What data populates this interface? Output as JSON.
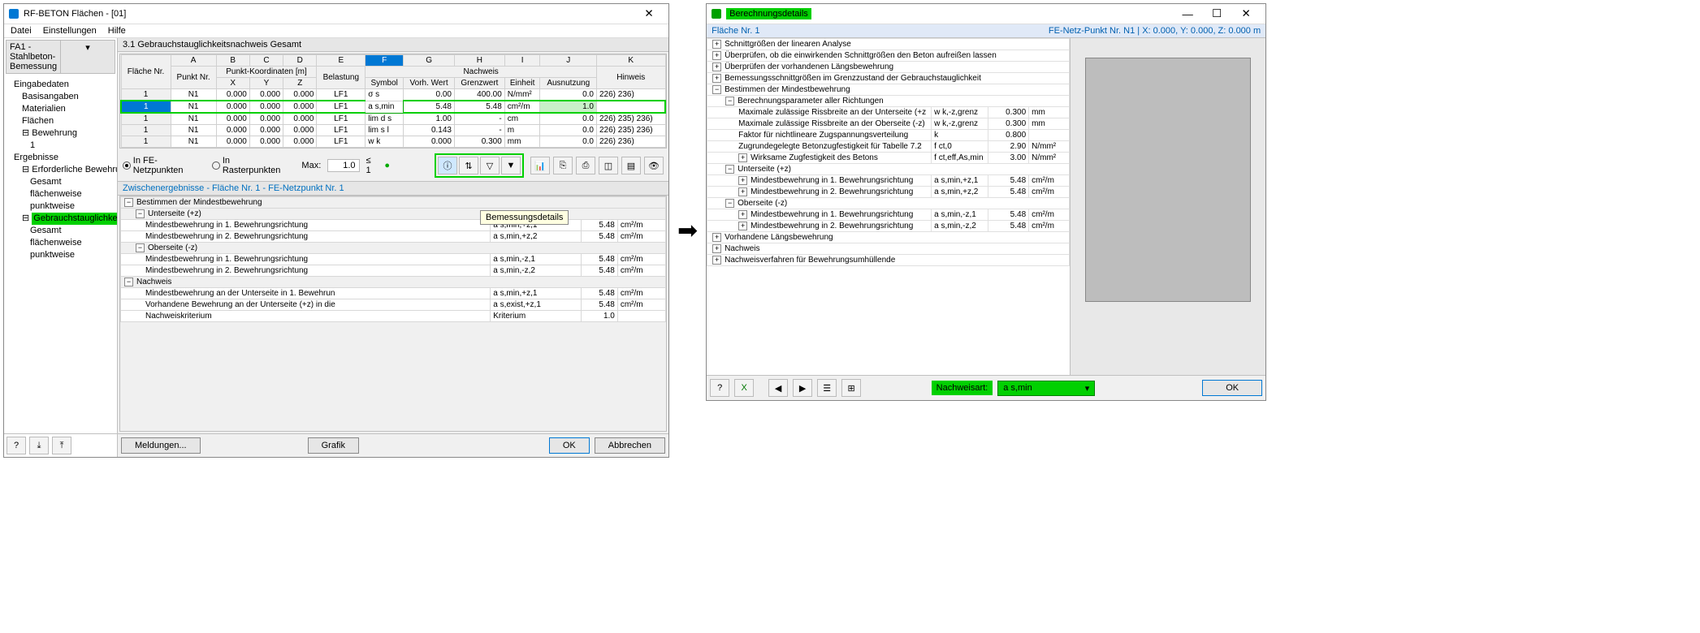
{
  "left": {
    "title": "RF-BETON Flächen - [01]",
    "menus": [
      "Datei",
      "Einstellungen",
      "Hilfe"
    ],
    "case_combo": "FA1 - Stahlbeton-Bemessung",
    "tree": {
      "input": "Eingabedaten",
      "input_items": [
        "Basisangaben",
        "Materialien",
        "Flächen"
      ],
      "bewehrung": "Bewehrung",
      "bewehrung_item": "1",
      "results": "Ergebnisse",
      "req": "Erforderliche Bewehrung",
      "req_items": [
        "Gesamt",
        "flächenweise",
        "punktweise"
      ],
      "gtn": "Gebrauchstauglichkeitsnachweis",
      "gtn_items": [
        "Gesamt",
        "flächenweise",
        "punktweise"
      ]
    },
    "section_title": "3.1 Gebrauchstauglichkeitsnachweis Gesamt",
    "table": {
      "letters": [
        "A",
        "B",
        "C",
        "D",
        "E",
        "F",
        "G",
        "H",
        "I",
        "J",
        "K"
      ],
      "headers": {
        "flaeche_nr": "Fläche\nNr.",
        "punkt_nr": "Punkt\nNr.",
        "pk_group": "Punkt-Koordinaten [m]",
        "x": "X",
        "y": "Y",
        "z": "Z",
        "belastung": "Belastung",
        "nw_group": "Nachweis",
        "symbol": "Symbol",
        "vorh": "Vorh. Wert",
        "grenz": "Grenzwert",
        "einheit": "Einheit",
        "ausnutz": "Ausnutzung",
        "hinweis": "Hinweis"
      },
      "rows": [
        {
          "fn": "1",
          "pn": "N1",
          "x": "0.000",
          "y": "0.000",
          "z": "0.000",
          "bel": "LF1",
          "sym": "σ s",
          "vw": "0.00",
          "gw": "400.00",
          "eh": "N/mm²",
          "an": "0.0",
          "hw": "226) 236)"
        },
        {
          "fn": "1",
          "pn": "N1",
          "x": "0.000",
          "y": "0.000",
          "z": "0.000",
          "bel": "LF1",
          "sym": "a s,min",
          "vw": "5.48",
          "gw": "5.48",
          "eh": "cm²/m",
          "an": "1.0",
          "hw": "",
          "hl": true
        },
        {
          "fn": "1",
          "pn": "N1",
          "x": "0.000",
          "y": "0.000",
          "z": "0.000",
          "bel": "LF1",
          "sym": "lim d s",
          "vw": "1.00",
          "gw": "-",
          "eh": "cm",
          "an": "0.0",
          "hw": "226) 235) 236)"
        },
        {
          "fn": "1",
          "pn": "N1",
          "x": "0.000",
          "y": "0.000",
          "z": "0.000",
          "bel": "LF1",
          "sym": "lim s l",
          "vw": "0.143",
          "gw": "-",
          "eh": "m",
          "an": "0.0",
          "hw": "226) 235) 236)"
        },
        {
          "fn": "1",
          "pn": "N1",
          "x": "0.000",
          "y": "0.000",
          "z": "0.000",
          "bel": "LF1",
          "sym": "w k",
          "vw": "0.000",
          "gw": "0.300",
          "eh": "mm",
          "an": "0.0",
          "hw": "226) 236)"
        }
      ]
    },
    "controls": {
      "radio1": "In FE-Netzpunkten",
      "radio2": "In Rasterpunkten",
      "max_label": "Max:",
      "max_value": "1.0",
      "max_cond": "≤ 1"
    },
    "tooltip": "Bemessungsdetails",
    "zw_title": "Zwischenergebnisse  -  Fläche Nr. 1 - FE-Netzpunkt Nr. 1",
    "zw": {
      "bestimmen": "Bestimmen der Mindestbewehrung",
      "unter": "Unterseite (+z)",
      "r1": "Mindestbewehrung in 1. Bewehrungsrichtung",
      "r1s": "a s,min,+z,1",
      "r1v": "5.48",
      "r1u": "cm²/m",
      "r2": "Mindestbewehrung in 2. Bewehrungsrichtung",
      "r2s": "a s,min,+z,2",
      "r2v": "5.48",
      "r2u": "cm²/m",
      "ober": "Oberseite (-z)",
      "r3": "Mindestbewehrung in 1. Bewehrungsrichtung",
      "r3s": "a s,min,-z,1",
      "r3v": "5.48",
      "r3u": "cm²/m",
      "r4": "Mindestbewehrung in 2. Bewehrungsrichtung",
      "r4s": "a s,min,-z,2",
      "r4v": "5.48",
      "r4u": "cm²/m",
      "nachweis": "Nachweis",
      "r5": "Mindestbewehrung an der Unterseite in 1. Bewehrun",
      "r5s": "a s,min,+z,1",
      "r5v": "5.48",
      "r5u": "cm²/m",
      "r6": "Vorhandene Bewehrung an der Unterseite (+z) in die",
      "r6s": "a s,exist,+z,1",
      "r6v": "5.48",
      "r6u": "cm²/m",
      "r7": "Nachweiskriterium",
      "r7s": "Kriterium",
      "r7v": "1.0",
      "r7u": ""
    },
    "footer": {
      "meldungen": "Meldungen...",
      "grafik": "Grafik",
      "ok": "OK",
      "abbrechen": "Abbrechen"
    }
  },
  "right": {
    "title": "Berechnungsdetails",
    "hdr_left": "Fläche Nr. 1",
    "hdr_right": "FE-Netz-Punkt Nr. N1  |  X: 0.000, Y: 0.000, Z: 0.000 m",
    "rows": [
      {
        "t": "grp",
        "p": 0,
        "label": "Schnittgrößen der linearen Analyse",
        "exp": "+"
      },
      {
        "t": "grp",
        "p": 0,
        "label": "Überprüfen, ob die einwirkenden Schnittgrößen den Beton aufreißen lassen",
        "exp": "+"
      },
      {
        "t": "grp",
        "p": 0,
        "label": "Überprüfen der vorhandenen Längsbewehrung",
        "exp": "+"
      },
      {
        "t": "grp",
        "p": 0,
        "label": "Bemessungsschnittgrößen im Grenzzustand der Gebrauchstauglichkeit",
        "exp": "+"
      },
      {
        "t": "grp",
        "p": 0,
        "label": "Bestimmen der Mindestbewehrung",
        "exp": "−"
      },
      {
        "t": "grp",
        "p": 1,
        "label": "Berechnungsparameter aller Richtungen",
        "exp": "−"
      },
      {
        "t": "val",
        "p": 2,
        "label": "Maximale zulässige Rissbreite an der Unterseite (+z",
        "sym": "w k,-z,grenz",
        "val": "0.300",
        "unit": "mm"
      },
      {
        "t": "val",
        "p": 2,
        "label": "Maximale zulässige Rissbreite an der Oberseite (-z)",
        "sym": "w k,-z,grenz",
        "val": "0.300",
        "unit": "mm"
      },
      {
        "t": "val",
        "p": 2,
        "label": "Faktor für nichtlineare Zugspannungsverteilung",
        "sym": "k",
        "val": "0.800",
        "unit": ""
      },
      {
        "t": "val",
        "p": 2,
        "label": "Zugrundegelegte Betonzugfestigkeit für Tabelle 7.2",
        "sym": "f ct,0",
        "val": "2.90",
        "unit": "N/mm²"
      },
      {
        "t": "grp",
        "p": 2,
        "label": "Wirksame Zugfestigkeit des Betons",
        "sym": "f ct,eff,As,min",
        "val": "3.00",
        "unit": "N/mm²",
        "exp": "+"
      },
      {
        "t": "grp",
        "p": 1,
        "label": "Unterseite (+z)",
        "exp": "−"
      },
      {
        "t": "grp",
        "p": 2,
        "label": "Mindestbewehrung in 1. Bewehrungsrichtung",
        "sym": "a s,min,+z,1",
        "val": "5.48",
        "unit": "cm²/m",
        "exp": "+"
      },
      {
        "t": "grp",
        "p": 2,
        "label": "Mindestbewehrung in 2. Bewehrungsrichtung",
        "sym": "a s,min,+z,2",
        "val": "5.48",
        "unit": "cm²/m",
        "exp": "+"
      },
      {
        "t": "grp",
        "p": 1,
        "label": "Oberseite (-z)",
        "exp": "−"
      },
      {
        "t": "grp",
        "p": 2,
        "label": "Mindestbewehrung in 1. Bewehrungsrichtung",
        "sym": "a s,min,-z,1",
        "val": "5.48",
        "unit": "cm²/m",
        "exp": "+"
      },
      {
        "t": "grp",
        "p": 2,
        "label": "Mindestbewehrung in 2. Bewehrungsrichtung",
        "sym": "a s,min,-z,2",
        "val": "5.48",
        "unit": "cm²/m",
        "exp": "+"
      },
      {
        "t": "grp",
        "p": 0,
        "label": "Vorhandene Längsbewehrung",
        "exp": "+"
      },
      {
        "t": "grp",
        "p": 0,
        "label": "Nachweis",
        "exp": "+"
      },
      {
        "t": "grp",
        "p": 0,
        "label": "Nachweisverfahren für Bewehrungsumhüllende",
        "exp": "+"
      }
    ],
    "footer": {
      "nw_label": "Nachweisart:",
      "nw_value": "a s,min",
      "ok": "OK"
    }
  }
}
